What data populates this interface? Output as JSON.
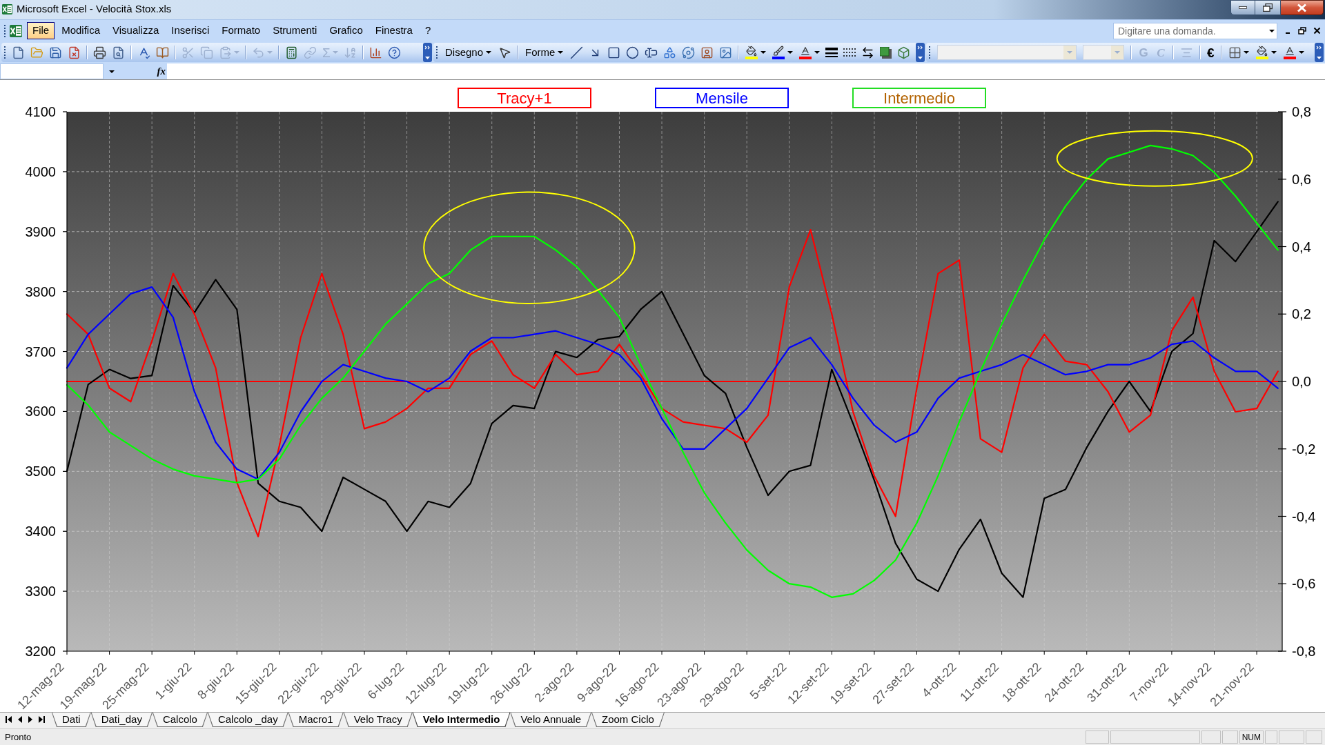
{
  "window": {
    "title": "Microsoft Excel - Velocità Stox.xls"
  },
  "menu_bar": {
    "items": [
      {
        "label": "File",
        "selected": true
      },
      {
        "label": "Modifica",
        "selected": false
      },
      {
        "label": "Visualizza",
        "selected": false
      },
      {
        "label": "Inserisci",
        "selected": false
      },
      {
        "label": "Formato",
        "selected": false
      },
      {
        "label": "Strumenti",
        "selected": false
      },
      {
        "label": "Grafico",
        "selected": false
      },
      {
        "label": "Finestra",
        "selected": false
      },
      {
        "label": "?",
        "selected": false
      }
    ],
    "question_box": {
      "placeholder": "Digitare una domanda."
    }
  },
  "standard_toolbar": {
    "sum": {
      "label": "Σ",
      "disabled": true
    }
  },
  "drawing_toolbar": {
    "menus": [
      "Disegno",
      "Forme"
    ]
  },
  "formatting_toolbar": {
    "buttons": [
      {
        "kind": "bold",
        "label": "G",
        "disabled": true
      },
      {
        "kind": "italic",
        "label": "C",
        "disabled": true
      }
    ],
    "currency": {
      "label": "€",
      "disabled": false
    }
  },
  "formula_bar": {
    "function_label": "fx"
  },
  "chart": {
    "legend": [
      {
        "color": "#ff0000",
        "text": {
          "label": "Tracy+1",
          "color": "#ff0000"
        }
      },
      {
        "color": "#0000ff",
        "text": {
          "label": "Mensile",
          "color": "#0000ff"
        }
      },
      {
        "color": "#22dd22",
        "text": {
          "label": "Intermedio",
          "color": "#b36200"
        }
      }
    ],
    "chart_data": {
      "type": "line",
      "grid": true,
      "categories": [
        "12-mag-22",
        null,
        "19-mag-22",
        null,
        "25-mag-22",
        null,
        "1-giu-22",
        null,
        "8-giu-22",
        null,
        "15-giu-22",
        null,
        "22-giu-22",
        null,
        "29-giu-22",
        null,
        "6-lug-22",
        null,
        "12-lug-22",
        null,
        "19-lug-22",
        null,
        "26-lug-22",
        null,
        "2-ago-22",
        null,
        "9-ago-22",
        null,
        "16-ago-22",
        null,
        "23-ago-22",
        null,
        "29-ago-22",
        null,
        "5-set-22",
        null,
        "12-set-22",
        null,
        "19-set-22",
        null,
        "27-set-22",
        null,
        "4-ott-22",
        null,
        "11-ott-22",
        null,
        "18-ott-22",
        null,
        "24-ott-22",
        null,
        "31-ott-22",
        null,
        "7-nov-22",
        null,
        "14-nov-22",
        null,
        "21-nov-22",
        null
      ],
      "ylim": [
        3200,
        4100
      ],
      "y2lim": [
        -0.8,
        0.8
      ],
      "yticks": [
        3200,
        3300,
        3400,
        3500,
        3600,
        3700,
        3800,
        3900,
        4000,
        4100
      ],
      "y2ticks": [
        {
          "value": 0.8,
          "label": "0,8"
        },
        {
          "value": 0.6,
          "label": "0,6"
        },
        {
          "value": 0.4,
          "label": "0,4"
        },
        {
          "value": 0.2,
          "label": "0,2"
        },
        {
          "value": 0,
          "label": "0,0"
        },
        {
          "value": -0.2,
          "label": "-0,2"
        },
        {
          "value": -0.4,
          "label": "-0,4"
        },
        {
          "value": -0.6,
          "label": "-0,6"
        },
        {
          "value": -0.8,
          "label": "-0,8"
        }
      ],
      "series": [
        {
          "color": "#ff0000",
          "axis": "y2",
          "values": [
            0,
            0,
            0,
            0,
            0,
            0,
            0,
            0,
            0,
            0,
            0,
            0,
            0,
            0,
            0,
            0,
            0,
            0,
            0,
            0,
            0,
            0,
            0,
            0,
            0,
            0,
            0,
            0,
            0,
            0,
            0,
            0,
            0,
            0,
            0,
            0,
            0,
            0,
            0,
            0,
            0,
            0,
            0,
            0,
            0,
            0,
            0,
            0,
            0,
            0,
            0,
            0,
            0,
            0,
            0,
            0,
            0,
            0
          ]
        },
        {
          "color": "#000000",
          "values": [
            3500,
            3645,
            3670,
            3655,
            3660,
            3810,
            3765,
            3820,
            3770,
            3480,
            3450,
            3440,
            3400,
            3490,
            3470,
            3450,
            3400,
            3450,
            3440,
            3480,
            3580,
            3610,
            3605,
            3700,
            3690,
            3720,
            3725,
            3770,
            3800,
            3730,
            3660,
            3630,
            3540,
            3460,
            3500,
            3510,
            3670,
            3580,
            3485,
            3380,
            3320,
            3300,
            3370,
            3420,
            3330,
            3290,
            3455,
            3470,
            3540,
            3600,
            3650,
            3600,
            3700,
            3730,
            3885,
            3850,
            3900,
            3950
          ]
        },
        {
          "color": "#ff0000",
          "axis": "y2",
          "values": [
            0.2,
            0.14,
            -0.02,
            -0.06,
            0.12,
            0.32,
            0.2,
            0.04,
            -0.3,
            -0.46,
            -0.19,
            0.13,
            0.32,
            0.14,
            -0.14,
            -0.12,
            -0.08,
            -0.02,
            -0.02,
            0.08,
            0.12,
            0.02,
            -0.02,
            0.08,
            0.02,
            0.03,
            0.11,
            0.02,
            -0.08,
            -0.12,
            -0.13,
            -0.14,
            -0.18,
            -0.1,
            0.28,
            0.45,
            0.2,
            -0.09,
            -0.28,
            -0.4,
            -0.02,
            0.32,
            0.36,
            -0.17,
            -0.21,
            0.04,
            0.14,
            0.06,
            0.05,
            -0.03,
            -0.15,
            -0.1,
            0.15,
            0.25,
            0.03,
            -0.09,
            -0.08,
            0.03
          ]
        },
        {
          "color": "#0000ff",
          "axis": "y2",
          "values": [
            0.04,
            0.14,
            0.2,
            0.26,
            0.28,
            0.19,
            -0.03,
            -0.18,
            -0.26,
            -0.29,
            -0.21,
            -0.09,
            0.0,
            0.05,
            0.03,
            0.01,
            0.0,
            -0.03,
            0.01,
            0.09,
            0.13,
            0.13,
            0.14,
            0.15,
            0.13,
            0.11,
            0.08,
            0.01,
            -0.11,
            -0.2,
            -0.2,
            -0.14,
            -0.08,
            0.01,
            0.1,
            0.13,
            0.05,
            -0.05,
            -0.13,
            -0.18,
            -0.15,
            -0.05,
            0.01,
            0.03,
            0.05,
            0.08,
            0.05,
            0.02,
            0.03,
            0.05,
            0.05,
            0.07,
            0.11,
            0.12,
            0.07,
            0.03,
            0.03,
            -0.02
          ]
        },
        {
          "color": "#00ff00",
          "axis": "y2",
          "values": [
            -0.01,
            -0.07,
            -0.15,
            -0.19,
            -0.23,
            -0.26,
            -0.28,
            -0.29,
            -0.3,
            -0.29,
            -0.23,
            -0.13,
            -0.05,
            0.01,
            0.09,
            0.17,
            0.23,
            0.29,
            0.32,
            0.39,
            0.43,
            0.43,
            0.43,
            0.39,
            0.34,
            0.27,
            0.19,
            0.05,
            -0.08,
            -0.21,
            -0.33,
            -0.42,
            -0.5,
            -0.56,
            -0.6,
            -0.61,
            -0.64,
            -0.63,
            -0.59,
            -0.53,
            -0.42,
            -0.28,
            -0.12,
            0.03,
            0.17,
            0.3,
            0.42,
            0.52,
            0.6,
            0.66,
            0.68,
            0.7,
            0.69,
            0.67,
            0.62,
            0.55,
            0.47,
            0.39
          ]
        }
      ]
    }
  },
  "sheet_tabs": [
    {
      "label": "Dati",
      "selected": false
    },
    {
      "label": "Dati_day",
      "selected": false
    },
    {
      "label": "Calcolo",
      "selected": false
    },
    {
      "label": "Calcolo _day",
      "selected": false
    },
    {
      "label": "Macro1",
      "selected": false
    },
    {
      "label": "Velo Tracy",
      "selected": false
    },
    {
      "label": "Velo Intermedio",
      "selected": true
    },
    {
      "label": "Velo Annuale",
      "selected": false
    },
    {
      "label": "Zoom Ciclo",
      "selected": false
    }
  ],
  "status_bar": {
    "text": "Pronto",
    "indicators": [
      "NUM"
    ]
  }
}
